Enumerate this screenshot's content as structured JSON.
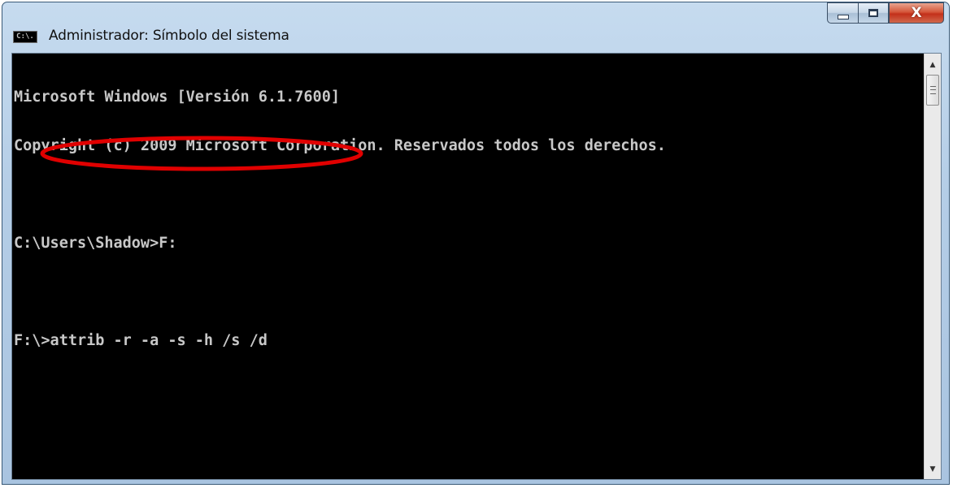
{
  "window": {
    "title": "Administrador: Símbolo del sistema",
    "icon_label": "C:\\.",
    "buttons": {
      "minimize": "minimize-icon",
      "maximize": "maximize-icon",
      "close": "X"
    }
  },
  "console": {
    "lines": [
      "Microsoft Windows [Versión 6.1.7600]",
      "Copyright (c) 2009 Microsoft Corporation. Reservados todos los derechos.",
      "",
      "C:\\Users\\Shadow>F:",
      "",
      "F:\\>attrib -r -a -s -h /s /d"
    ],
    "text_color": "#c8c8c8",
    "background": "#000000"
  },
  "annotation": {
    "shape": "ellipse",
    "color": "#e00000"
  }
}
